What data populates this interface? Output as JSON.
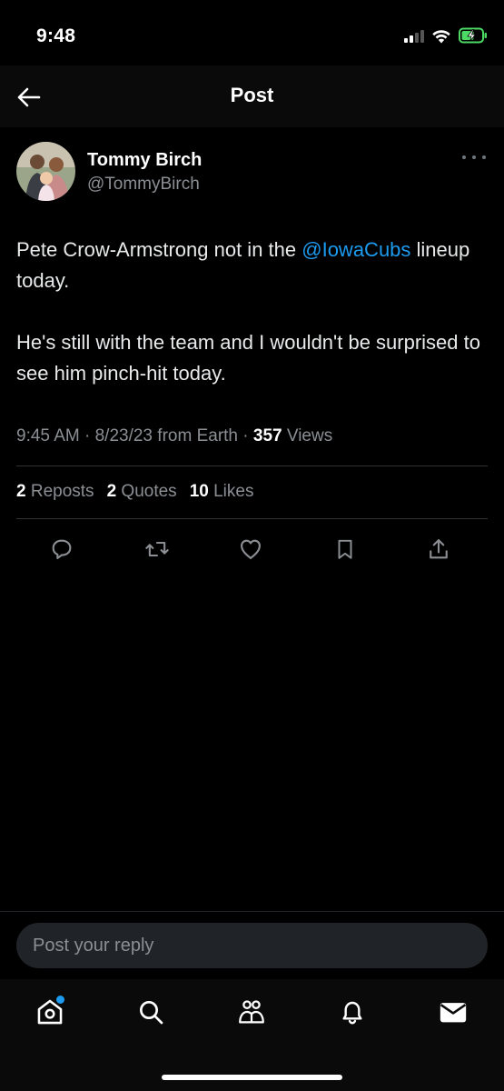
{
  "status_bar": {
    "time": "9:48"
  },
  "header": {
    "title": "Post"
  },
  "tweet": {
    "author_name": "Tommy Birch",
    "author_handle": "@TommyBirch",
    "text_part1": "Pete Crow-Armstrong not in the ",
    "mention": "@IowaCubs",
    "text_part2": " lineup today.",
    "text_paragraph2": "He's still with the team and I wouldn't be surprised to see him pinch-hit today.",
    "time": "9:45 AM",
    "date": "8/23/23",
    "source": "from Earth",
    "views_count": "357",
    "views_label": "Views",
    "reposts_count": "2",
    "reposts_label": "Reposts",
    "quotes_count": "2",
    "quotes_label": "Quotes",
    "likes_count": "10",
    "likes_label": "Likes"
  },
  "reply": {
    "placeholder": "Post your reply"
  },
  "tabbar": {
    "items": [
      {
        "name": "home",
        "icon": "home-icon"
      },
      {
        "name": "search",
        "icon": "search-icon"
      },
      {
        "name": "communities",
        "icon": "communities-icon"
      },
      {
        "name": "notifications",
        "icon": "bell-icon"
      },
      {
        "name": "messages",
        "icon": "mail-icon"
      }
    ]
  },
  "colors": {
    "accent": "#1d9bf0",
    "background": "#000000",
    "muted": "#8b8f94",
    "battery": "#4cd964"
  }
}
